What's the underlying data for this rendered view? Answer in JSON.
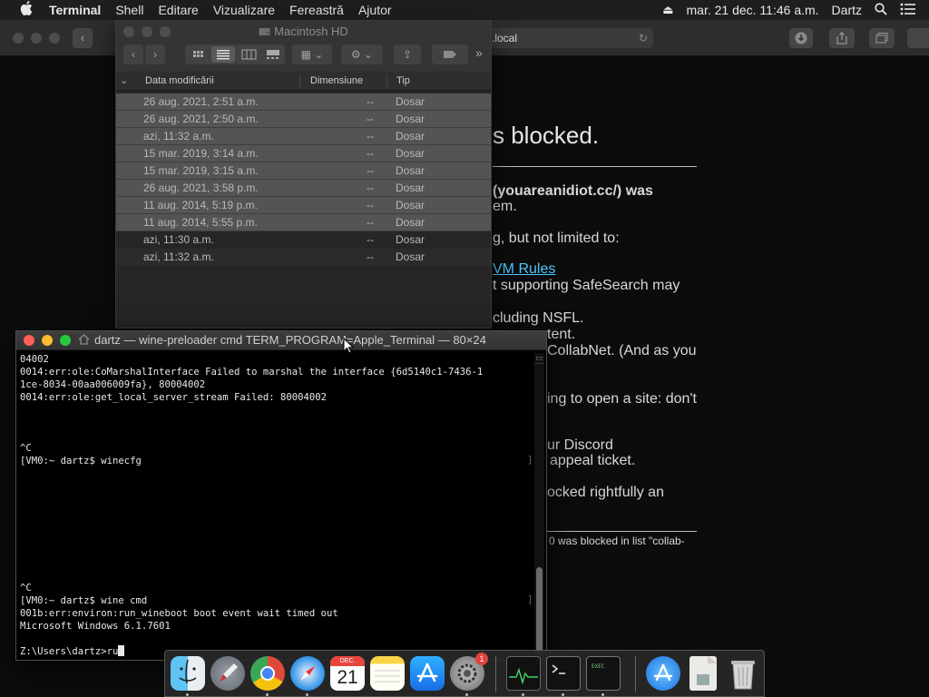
{
  "menubar": {
    "apple": "",
    "app": "Terminal",
    "items": [
      "Shell",
      "Editare",
      "Vizualizare",
      "Fereastră",
      "Ajutor"
    ],
    "eject": "⏏",
    "datetime": "mar. 21 dec.  11:46 a.m.",
    "user": "Dartz",
    "search_icon": "⌕",
    "list_icon": "☰"
  },
  "browser": {
    "url": ".local",
    "page": {
      "heading": "s blocked.",
      "line1": "(youareanidiot.cc/) was",
      "line2": "em.",
      "line3": "g, but not limited to:",
      "link": "VM Rules",
      "line4": "t supporting SafeSearch may",
      "line5": "cluding NSFL.",
      "line6": "tent.",
      "line7": "CollabNet. (And as you",
      "line8": "ing to open a site: don't",
      "line9": "ur Discord",
      "line10": "appeal ticket.",
      "line11": "ocked rightfully an",
      "footer": "0 was blocked in list \"collab-"
    }
  },
  "finder": {
    "title": "Macintosh HD",
    "columns": [
      "Data modificării",
      "Dimensiune",
      "Tip"
    ],
    "rows": [
      {
        "date": "26 aug. 2021, 2:51 a.m.",
        "size": "--",
        "kind": "Dosar"
      },
      {
        "date": "26 aug. 2021, 2:50 a.m.",
        "size": "--",
        "kind": "Dosar"
      },
      {
        "date": "azi, 11:32 a.m.",
        "size": "--",
        "kind": "Dosar"
      },
      {
        "date": "15 mar. 2019, 3:14 a.m.",
        "size": "--",
        "kind": "Dosar"
      },
      {
        "date": "15 mar. 2019, 3:15 a.m.",
        "size": "--",
        "kind": "Dosar"
      },
      {
        "date": "26 aug. 2021, 3:58 p.m.",
        "size": "--",
        "kind": "Dosar"
      },
      {
        "date": "11 aug. 2014, 5:19 p.m.",
        "size": "--",
        "kind": "Dosar"
      },
      {
        "date": "11 aug. 2014, 5:55 p.m.",
        "size": "--",
        "kind": "Dosar"
      },
      {
        "date": "azi, 11:30 a.m.",
        "size": "--",
        "kind": "Dosar"
      },
      {
        "date": "azi, 11:32 a.m.",
        "size": "--",
        "kind": "Dosar"
      }
    ]
  },
  "terminal": {
    "title": "dartz — wine-preloader cmd TERM_PROGRAM=Apple_Terminal — 80×24",
    "lines": [
      "04002",
      "0014:err:ole:CoMarshalInterface Failed to marshal the interface {6d5140c1-7436-1",
      "1ce-8034-00aa006009fa}, 80004002",
      "0014:err:ole:get_local_server_stream Failed: 80004002",
      "",
      "",
      "",
      "^C",
      "[VM0:~ dartz$ winecfg",
      "",
      "",
      "",
      "",
      "",
      "",
      "",
      "",
      "",
      "^C",
      "[VM0:~ dartz$ wine cmd",
      "001b:err:environ:run_wineboot boot event wait timed out",
      "Microsoft Windows 6.1.7601",
      "",
      "Z:\\Users\\dartz>ru"
    ]
  },
  "dock": {
    "calendar_month": "DEC.",
    "calendar_day": "21",
    "appstore_badge": "1"
  },
  "colors": {
    "close": "#fe5f57",
    "minimize": "#febc2e",
    "zoom": "#28c840",
    "link": "#4fc8ff"
  }
}
